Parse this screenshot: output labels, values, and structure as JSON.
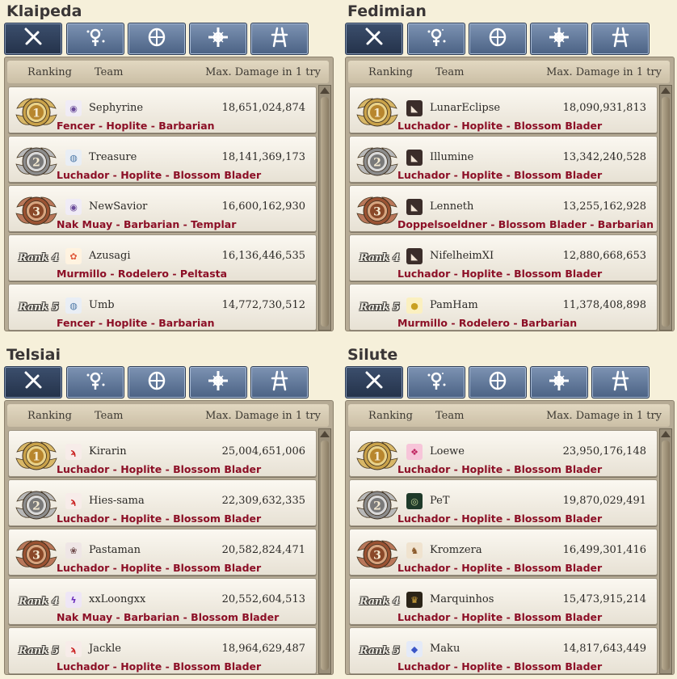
{
  "header_labels": {
    "ranking": "Ranking",
    "team": "Team",
    "max_damage": "Max. Damage in 1 try"
  },
  "class_tabs": [
    {
      "icon": "swordsman-class-icon",
      "active": true
    },
    {
      "icon": "wizard-class-icon"
    },
    {
      "icon": "archer-class-icon"
    },
    {
      "icon": "cleric-class-icon"
    },
    {
      "icon": "scout-class-icon"
    }
  ],
  "colors": {
    "class_text": "#8c0f26",
    "tab_active": "#24324a",
    "tab": "#5a7093",
    "gold": "#c9a24a",
    "silver": "#9a9a9a",
    "bronze": "#9a5232"
  },
  "medal_numbers": [
    "1",
    "2",
    "3"
  ],
  "servers": [
    {
      "name": "Klaipeda",
      "entries": [
        {
          "rank_label": "",
          "team": "Sephyrine",
          "damage": "18,651,024,874",
          "classes": "Fencer - Hoplite - Barbarian",
          "avatar": "pig-avatar-icon"
        },
        {
          "rank_label": "",
          "team": "Treasure",
          "damage": "18,141,369,173",
          "classes": "Luchador - Hoplite - Blossom Blader",
          "avatar": "round-creature-avatar-icon"
        },
        {
          "rank_label": "",
          "team": "NewSavior",
          "damage": "16,600,162,930",
          "classes": "Nak Muay - Barbarian - Templar",
          "avatar": "pig-avatar-icon"
        },
        {
          "rank_label": "Rank 4",
          "team": "Azusagi",
          "damage": "16,136,446,535",
          "classes": "Murmillo - Rodelero - Peltasta",
          "avatar": "flower-avatar-icon"
        },
        {
          "rank_label": "Rank 5",
          "team": "Umb",
          "damage": "14,772,730,512",
          "classes": "Fencer - Hoplite - Barbarian",
          "avatar": "round-creature-avatar-icon"
        }
      ]
    },
    {
      "name": "Fedimian",
      "entries": [
        {
          "rank_label": "",
          "team": "LunarEclipse",
          "damage": "18,090,931,813",
          "classes": "Luchador - Hoplite - Blossom Blader",
          "avatar": "anime-portrait-avatar-icon"
        },
        {
          "rank_label": "",
          "team": "Illumine",
          "damage": "13,342,240,528",
          "classes": "Luchador - Hoplite - Blossom Blader",
          "avatar": "anime-portrait-avatar-icon"
        },
        {
          "rank_label": "",
          "team": "Lenneth",
          "damage": "13,255,162,928",
          "classes": "Doppelsoeldner - Blossom Blader - Barbarian",
          "avatar": "anime-portrait-avatar-icon"
        },
        {
          "rank_label": "Rank 4",
          "team": "NifelheimXI",
          "damage": "12,880,668,653",
          "classes": "Luchador - Hoplite - Blossom Blader",
          "avatar": "anime-portrait-avatar-icon"
        },
        {
          "rank_label": "Rank 5",
          "team": "PamHam",
          "damage": "11,378,408,898",
          "classes": "Murmillo - Rodelero - Barbarian",
          "avatar": "chick-avatar-icon"
        }
      ]
    },
    {
      "name": "Telsiai",
      "entries": [
        {
          "rank_label": "",
          "team": "Kirarin",
          "damage": "25,004,651,006",
          "classes": "Luchador - Hoplite - Blossom Blader",
          "avatar": "red-bird-avatar-icon"
        },
        {
          "rank_label": "",
          "team": "Hies-sama",
          "damage": "22,309,632,335",
          "classes": "Luchador - Hoplite - Blossom Blader",
          "avatar": "red-bird-avatar-icon"
        },
        {
          "rank_label": "",
          "team": "Pastaman",
          "damage": "20,582,824,471",
          "classes": "Luchador - Hoplite - Blossom Blader",
          "avatar": "paw-avatar-icon"
        },
        {
          "rank_label": "Rank 4",
          "team": "xxLoongxx",
          "damage": "20,552,604,513",
          "classes": "Nak Muay - Barbarian - Blossom Blader",
          "avatar": "purple-dragon-avatar-icon"
        },
        {
          "rank_label": "Rank 5",
          "team": "Jackle",
          "damage": "18,964,629,487",
          "classes": "Luchador - Hoplite - Blossom Blader",
          "avatar": "red-bird-avatar-icon"
        }
      ]
    },
    {
      "name": "Silute",
      "entries": [
        {
          "rank_label": "",
          "team": "Loewe",
          "damage": "23,950,176,148",
          "classes": "Luchador - Hoplite - Blossom Blader",
          "avatar": "pink-creature-avatar-icon"
        },
        {
          "rank_label": "",
          "team": "PeT",
          "damage": "19,870,029,491",
          "classes": "Luchador - Hoplite - Blossom Blader",
          "avatar": "green-emblem-avatar-icon"
        },
        {
          "rank_label": "",
          "team": "Kromzera",
          "damage": "16,499,301,416",
          "classes": "Luchador - Hoplite - Blossom Blader",
          "avatar": "horse-avatar-icon"
        },
        {
          "rank_label": "Rank 4",
          "team": "Marquinhos",
          "damage": "15,473,915,214",
          "classes": "Luchador - Hoplite - Blossom Blader",
          "avatar": "lion-avatar-icon"
        },
        {
          "rank_label": "Rank 5",
          "team": "Maku",
          "damage": "14,817,643,449",
          "classes": "Luchador - Hoplite - Blossom Blader",
          "avatar": "blue-crystal-avatar-icon"
        }
      ]
    }
  ]
}
